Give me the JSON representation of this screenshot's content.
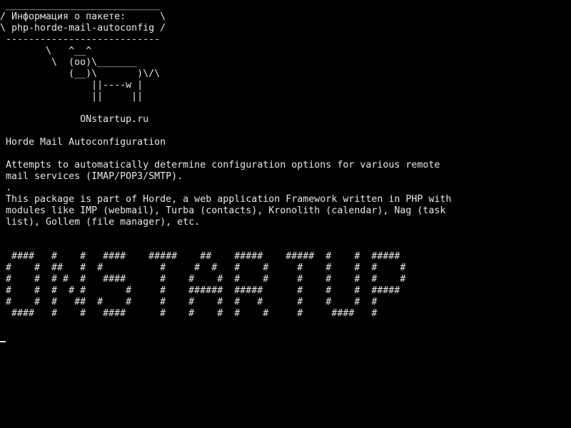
{
  "terminal": {
    "lines": [
      " ___________________________",
      "/ Информация о пакете:      \\",
      "\\ php-horde-mail-autoconfig /",
      " ---------------------------",
      "        \\   ^__^",
      "         \\  (oo)\\_______",
      "            (__)\\       )\\/\\",
      "                ||----w |",
      "                ||     ||",
      "",
      "              ONstartup.ru",
      "",
      " Horde Mail Autoconfiguration",
      "",
      " Attempts to automatically determine configuration options for various remote",
      " mail services (IMAP/POP3/SMTP).",
      " .",
      " This package is part of Horde, a web application Framework written in PHP with",
      " modules like IMP (webmail), Turba (contacts), Kronolith (calendar), Nag (task",
      " list), Gollem (file manager), etc.",
      "",
      "",
      "  ####   #    #   ####    #####    ##    #####    #####  #    #  #####",
      " #    #  ##   #  #          #     #  #   #    #     #    #    #  #    #",
      " #    #  # #  #   ####      #    #    #  #    #     #    #    #  #    #",
      " #    #  #  # #       #     #    ######  #####      #    #    #  #####",
      " #    #  #   ##  #    #     #    #    #  #   #      #    #    #  #",
      "  ####   #    #   ####      #    #    #  #    #     #     ####   #"
    ]
  }
}
